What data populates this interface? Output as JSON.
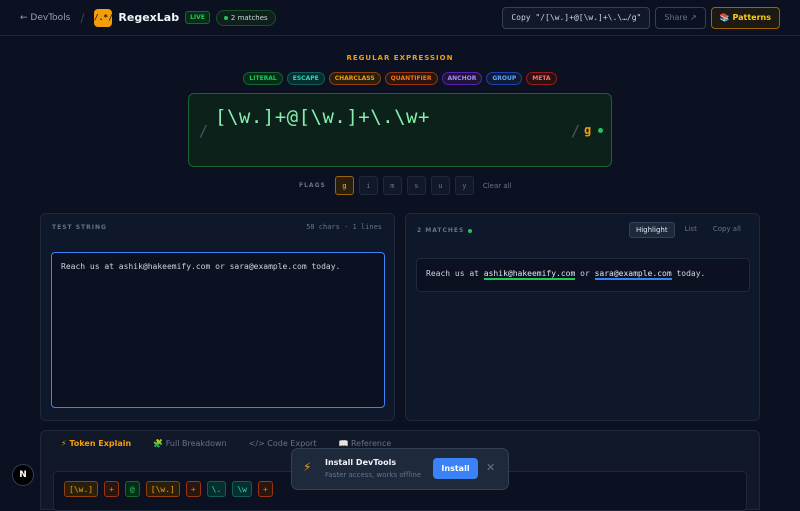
{
  "topbar": {
    "back_label": "← DevTools",
    "separator": "/",
    "logo_glyph": "/.*/",
    "app_name": "RegexLab",
    "live_badge": "LIVE",
    "match_count": "2 matches",
    "copy_label": "Copy \"/[\\w.]+@[\\w.]+\\.\\…/g\"",
    "share_label": "Share ↗",
    "patterns_label": "📚 Patterns"
  },
  "regex": {
    "section_label": "REGULAR EXPRESSION",
    "legend": [
      {
        "label": "LITERAL",
        "color": "#22c55e"
      },
      {
        "label": "ESCAPE",
        "color": "#2dd4bf"
      },
      {
        "label": "CHARCLASS",
        "color": "#f59e0b"
      },
      {
        "label": "QUANTIFIER",
        "color": "#f97316"
      },
      {
        "label": "ANCHOR",
        "color": "#a78bfa"
      },
      {
        "label": "GROUP",
        "color": "#60a5fa"
      },
      {
        "label": "META",
        "color": "#f87171"
      }
    ],
    "open_slash": "/",
    "pattern": "[\\w.]+@[\\w.]+\\.\\w+",
    "close_slash": "/",
    "active_flags": "g"
  },
  "flags": {
    "label": "FLAGS",
    "items": [
      {
        "label": "g",
        "active": true
      },
      {
        "label": "i",
        "active": false
      },
      {
        "label": "m",
        "active": false
      },
      {
        "label": "s",
        "active": false
      },
      {
        "label": "u",
        "active": false
      },
      {
        "label": "y",
        "active": false
      }
    ],
    "clear_label": "Clear all"
  },
  "test_panel": {
    "heading": "TEST STRING",
    "stats": "58 chars · 1 lines",
    "value": "Reach us at ashik@hakeemify.com or sara@example.com today."
  },
  "result_panel": {
    "heading": "2 MATCHES",
    "tabs": [
      "Highlight",
      "List",
      "Copy all"
    ],
    "text_before": "Reach us at ",
    "match1": "ashik@hakeemify.com",
    "text_between": " or ",
    "match2": "sara@example.com",
    "text_after": " today."
  },
  "bottom": {
    "tabs": [
      "⚡ Token Explain",
      "🧩 Full Breakdown",
      "</> Code Export",
      "📖 Reference"
    ],
    "tokens": [
      {
        "label": "[\\w.]",
        "color": "#f59e0b"
      },
      {
        "label": "+",
        "color": "#f97316"
      },
      {
        "label": "@",
        "color": "#22c55e"
      },
      {
        "label": "[\\w.]",
        "color": "#f59e0b"
      },
      {
        "label": "+",
        "color": "#f97316"
      },
      {
        "label": "\\.",
        "color": "#2dd4bf"
      },
      {
        "label": "\\w",
        "color": "#2dd4bf"
      },
      {
        "label": "+",
        "color": "#f97316"
      }
    ]
  },
  "toast": {
    "icon": "⚡",
    "title": "Install DevTools",
    "subtitle": "Faster access, works offline",
    "install_label": "Install",
    "close_glyph": "✕"
  },
  "corner_badge": "N",
  "colors": {
    "accent": "#f59e0b",
    "match_green": "#22c55e",
    "match_blue": "#3b82f6"
  }
}
